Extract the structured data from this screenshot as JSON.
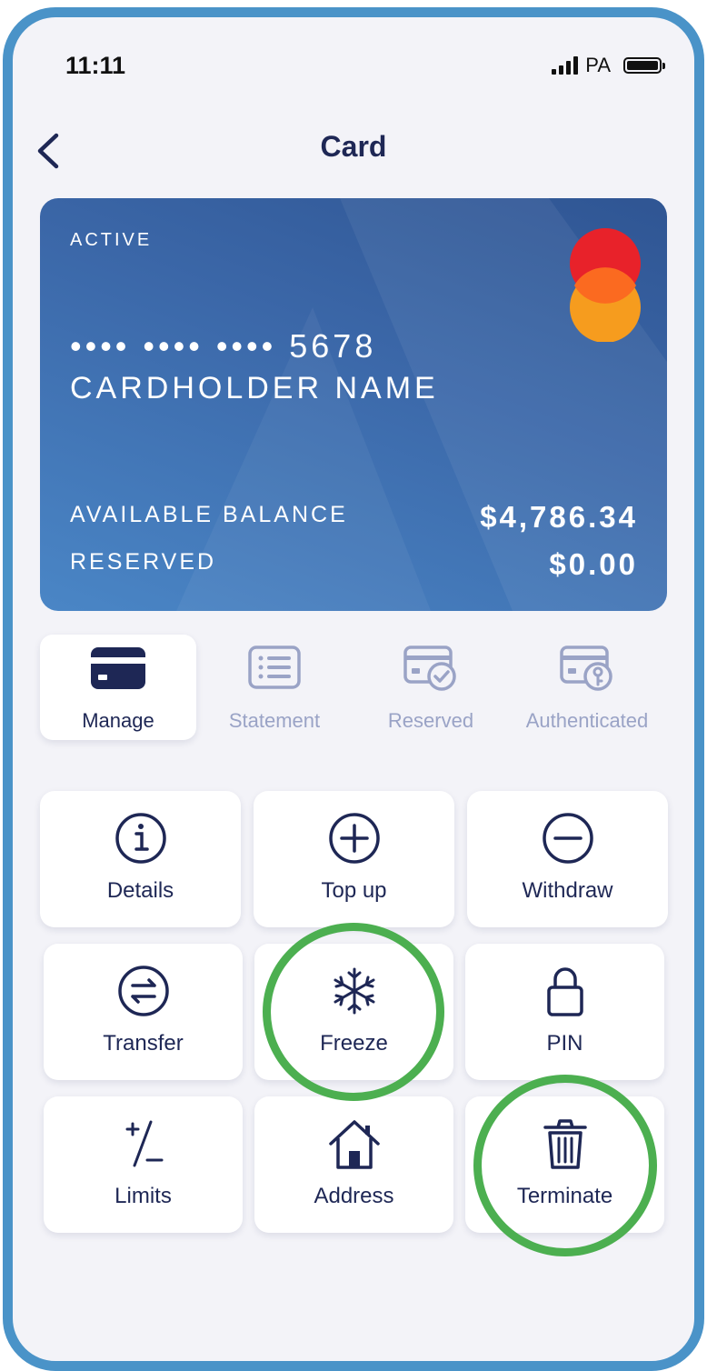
{
  "status_bar": {
    "time": "11:11",
    "carrier": "PA"
  },
  "nav": {
    "title": "Card"
  },
  "card": {
    "status": "ACTIVE",
    "number": "•••• •••• •••• 5678",
    "holder": "CARDHOLDER NAME",
    "available_label": "AVAILABLE BALANCE",
    "available_value": "$4,786.34",
    "reserved_label": "RESERVED",
    "reserved_value": "$0.00",
    "logo_colors": [
      "#e8222a",
      "#f69c1e"
    ]
  },
  "tabs": [
    {
      "label": "Manage",
      "icon": "credit-card-icon",
      "active": true
    },
    {
      "label": "Statement",
      "icon": "statement-list-icon",
      "active": false
    },
    {
      "label": "Reserved",
      "icon": "card-check-icon",
      "active": false
    },
    {
      "label": "Authenticated",
      "icon": "card-key-icon",
      "active": false
    }
  ],
  "actions": [
    {
      "label": "Details",
      "icon": "info-icon"
    },
    {
      "label": "Top up",
      "icon": "plus-circle-icon"
    },
    {
      "label": "Withdraw",
      "icon": "minus-circle-icon"
    },
    {
      "label": "Transfer",
      "icon": "transfer-icon"
    },
    {
      "label": "Freeze",
      "icon": "snowflake-icon"
    },
    {
      "label": "PIN",
      "icon": "lock-icon"
    },
    {
      "label": "Limits",
      "icon": "plus-minus-icon"
    },
    {
      "label": "Address",
      "icon": "home-icon"
    },
    {
      "label": "Terminate",
      "icon": "trash-icon"
    }
  ],
  "colors": {
    "accent": "#1e2755",
    "inactive": "#9aa3c6",
    "frame": "#4a93c8",
    "highlight": "#4caf50"
  }
}
